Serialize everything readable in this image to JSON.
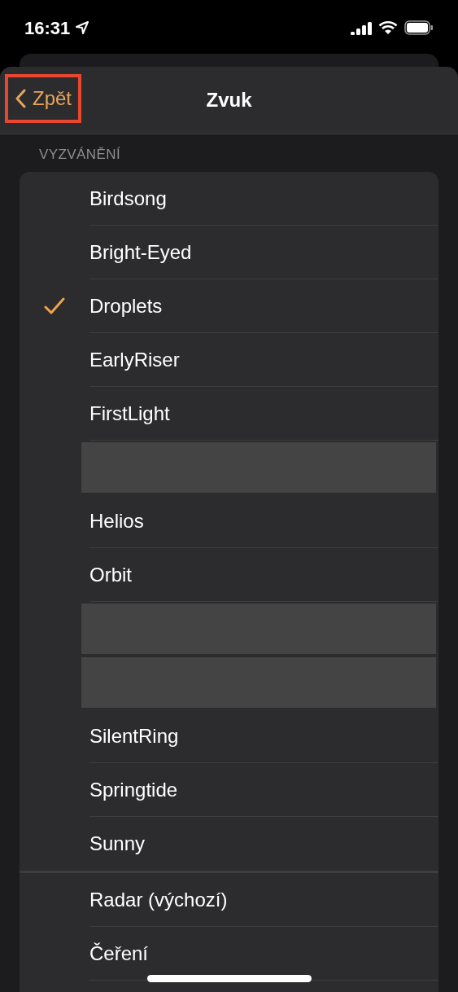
{
  "status_bar": {
    "time": "16:31"
  },
  "nav": {
    "back": "Zpět",
    "title": "Zvuk"
  },
  "sections": [
    {
      "header": "VYZVÁNĚNÍ",
      "items": [
        {
          "kind": "tone",
          "name": "Birdsong",
          "selected": false
        },
        {
          "kind": "tone",
          "name": "Bright-Eyed",
          "selected": false
        },
        {
          "kind": "tone",
          "name": "Droplets",
          "selected": true
        },
        {
          "kind": "tone",
          "name": "EarlyRiser",
          "selected": false
        },
        {
          "kind": "tone",
          "name": "FirstLight",
          "selected": false
        },
        {
          "kind": "redacted"
        },
        {
          "kind": "tone",
          "name": "Helios",
          "selected": false
        },
        {
          "kind": "tone",
          "name": "Orbit",
          "selected": false
        },
        {
          "kind": "redacted"
        },
        {
          "kind": "redacted"
        },
        {
          "kind": "tone",
          "name": "SilentRing",
          "selected": false
        },
        {
          "kind": "tone",
          "name": "Springtide",
          "selected": false
        },
        {
          "kind": "tone",
          "name": "Sunny",
          "selected": false
        }
      ]
    },
    {
      "items": [
        {
          "kind": "tone",
          "name": "Radar (výchozí)",
          "selected": false
        },
        {
          "kind": "tone",
          "name": "Čeření",
          "selected": false
        }
      ]
    }
  ]
}
